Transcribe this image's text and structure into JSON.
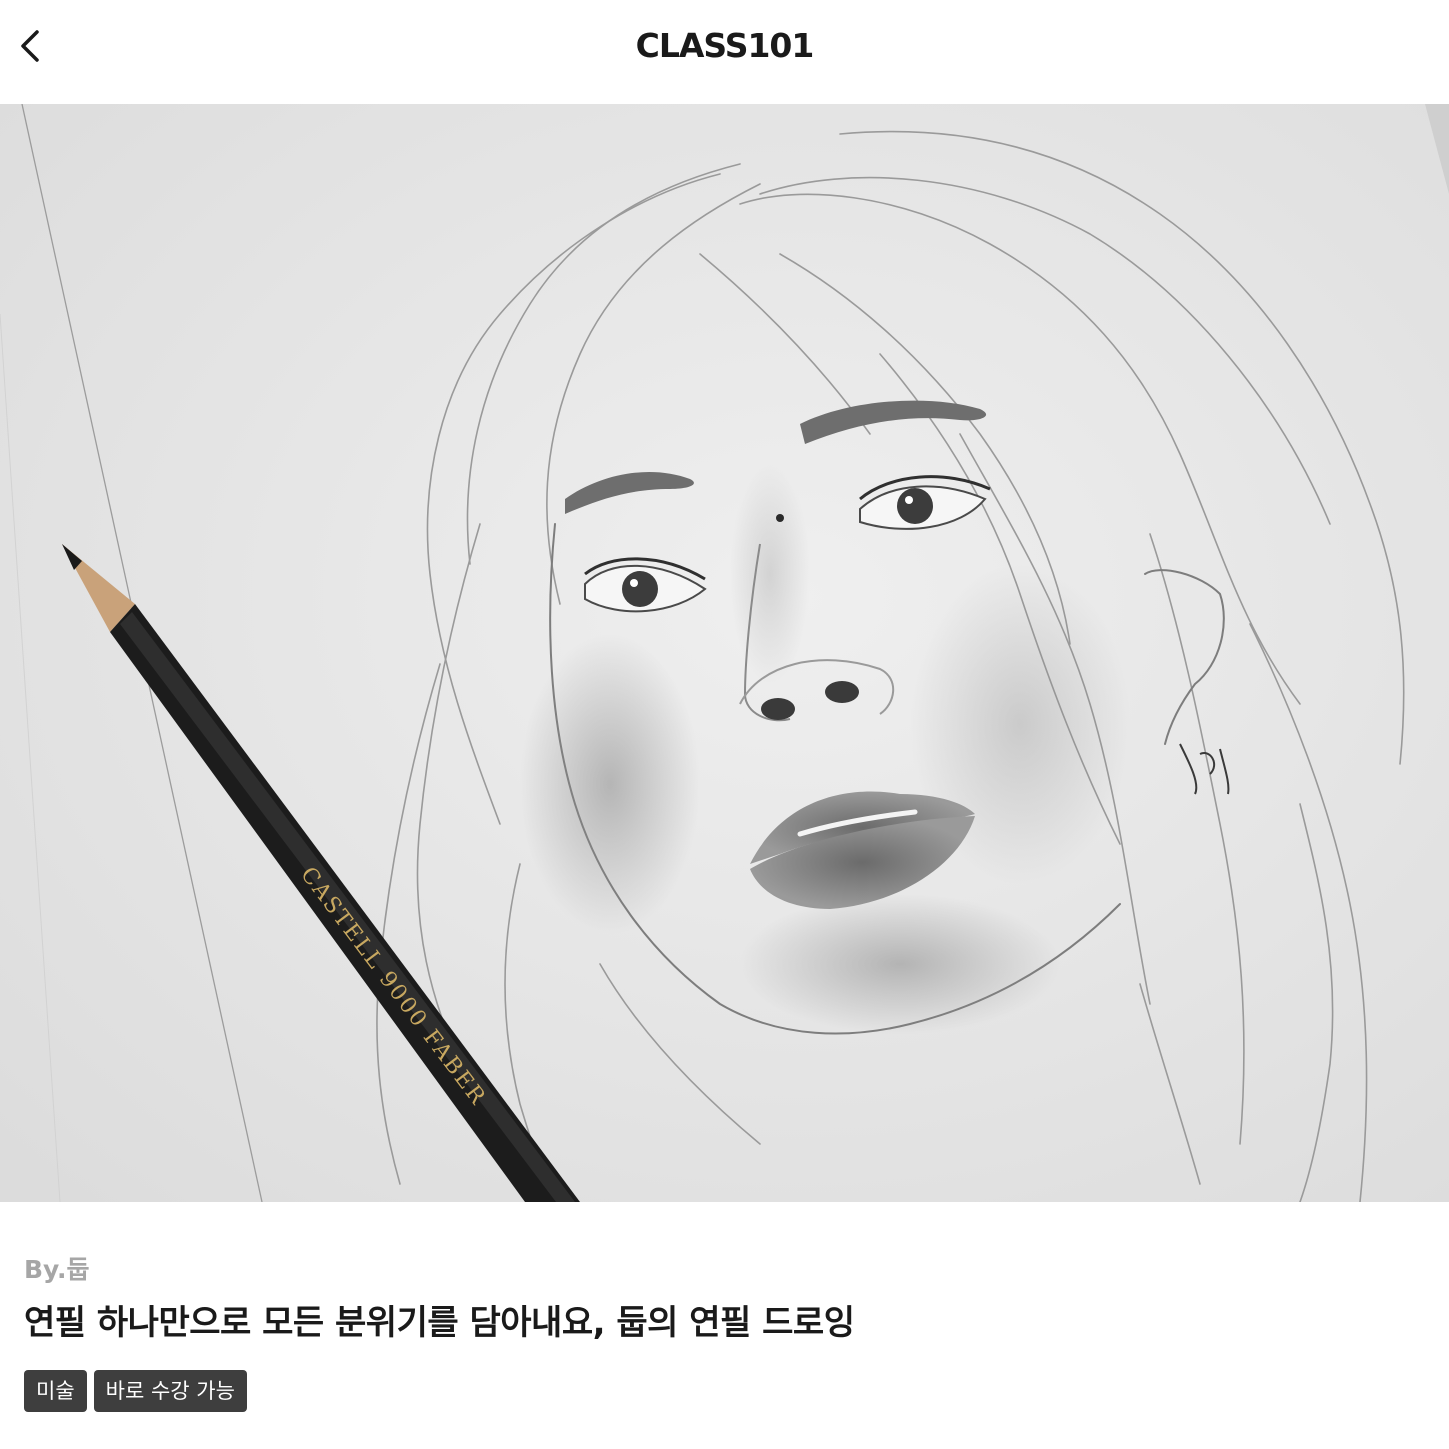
{
  "header": {
    "brand": "CLASS101",
    "back_icon": "chevron-left-icon"
  },
  "hero": {
    "image": "pencil-portrait-sketch-with-faber-castell-pencil",
    "pencil_text": "CASTELL 9000 FABER"
  },
  "course": {
    "creator": "By.둡",
    "title": "연필 하나만으로 모든 분위기를 담아내요, 둡의 연필 드로잉",
    "tags": [
      "미술",
      "바로 수강 가능"
    ]
  },
  "colors": {
    "tag_bg": "#3e3e3e",
    "creator_text": "#a6a6a6",
    "title_text": "#1a1a1a"
  }
}
